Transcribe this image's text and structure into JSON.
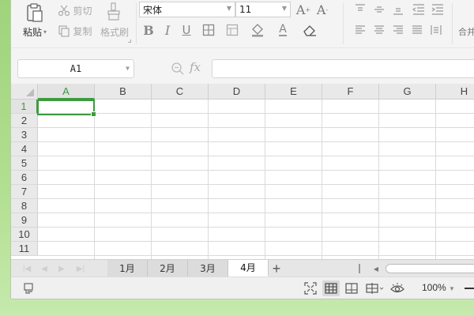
{
  "ribbon": {
    "paste_label": "粘贴",
    "cut_label": "剪切",
    "copy_label": "复制",
    "format_painter_label": "格式刷",
    "font_name": "宋体",
    "font_size": "11",
    "merge_label": "合并"
  },
  "formula_bar": {
    "cell_ref": "A1",
    "fx_label": "fx",
    "formula_value": ""
  },
  "grid": {
    "columns": [
      "A",
      "B",
      "C",
      "D",
      "E",
      "F",
      "G",
      "H"
    ],
    "rows": [
      "1",
      "2",
      "3",
      "4",
      "5",
      "6",
      "7",
      "8",
      "9",
      "10",
      "11"
    ],
    "selected_cell": "A1"
  },
  "sheets": {
    "tabs": [
      "1月",
      "2月",
      "3月",
      "4月"
    ],
    "active_tab": "4月",
    "add_label": "+"
  },
  "status": {
    "zoom": "100%"
  },
  "colors": {
    "accent": "#3f9a3f",
    "background": "#9fd37c"
  }
}
